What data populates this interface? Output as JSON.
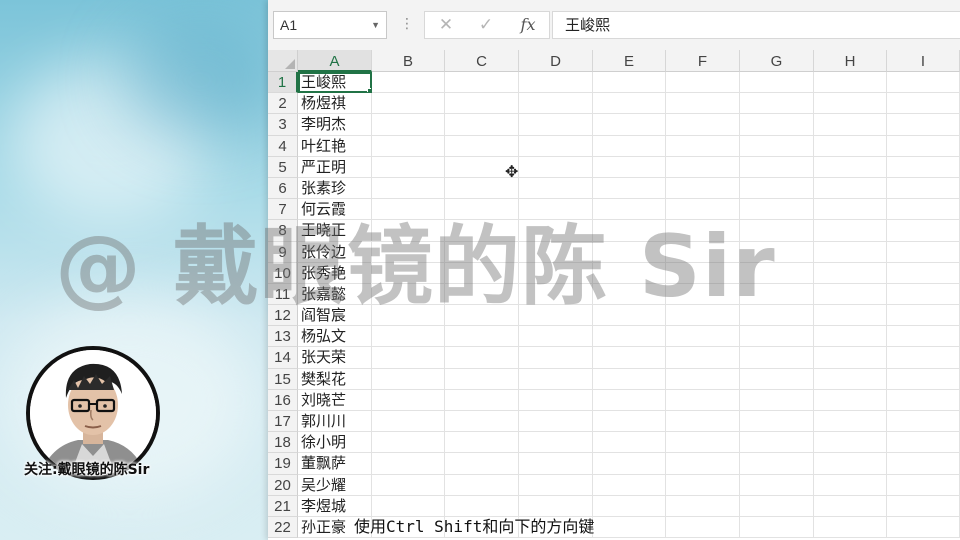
{
  "formula_bar": {
    "name_box": "A1",
    "cancel_symbol": "✕",
    "enter_symbol": "✓",
    "fx_symbol": "fx",
    "formula_value": "王峻熙"
  },
  "columns": [
    "A",
    "B",
    "C",
    "D",
    "E",
    "F",
    "G",
    "H",
    "I"
  ],
  "selected_cell": "A1",
  "rows": [
    {
      "num": "1",
      "a": "王峻熙"
    },
    {
      "num": "2",
      "a": "杨煜祺"
    },
    {
      "num": "3",
      "a": "李明杰"
    },
    {
      "num": "4",
      "a": "叶红艳"
    },
    {
      "num": "5",
      "a": "严正明"
    },
    {
      "num": "6",
      "a": "张素珍"
    },
    {
      "num": "7",
      "a": "何云霞"
    },
    {
      "num": "8",
      "a": "王晓正"
    },
    {
      "num": "9",
      "a": "张伶边"
    },
    {
      "num": "10",
      "a": "张秀艳"
    },
    {
      "num": "11",
      "a": "张嘉懿"
    },
    {
      "num": "12",
      "a": "阎智宸"
    },
    {
      "num": "13",
      "a": "杨弘文"
    },
    {
      "num": "14",
      "a": "张天荣"
    },
    {
      "num": "15",
      "a": "樊梨花"
    },
    {
      "num": "16",
      "a": "刘晓芒"
    },
    {
      "num": "17",
      "a": "郭川川"
    },
    {
      "num": "18",
      "a": "徐小明"
    },
    {
      "num": "19",
      "a": "董飘萨"
    },
    {
      "num": "20",
      "a": "吴少耀"
    },
    {
      "num": "21",
      "a": "李煜城"
    },
    {
      "num": "22",
      "a": "孙正豪"
    }
  ],
  "watermark": "@ 戴眼镜的陈 Sir",
  "avatar_caption": "关注:戴眼镜的陈Sir",
  "subtitle": "使用Ctrl Shift和向下的方向键"
}
